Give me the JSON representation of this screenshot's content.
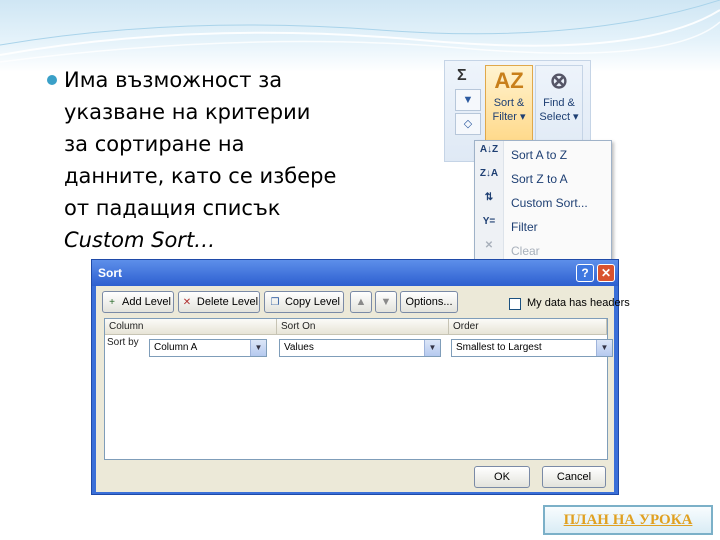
{
  "slide": {
    "bullet_lines": [
      "Има възможност за",
      "указване на критерии",
      "за сортиране на",
      "данните, като се избере",
      "от падащия списък"
    ],
    "bullet_italic": "Custom Sort…",
    "plan_link": "ПЛАН НА УРОКА"
  },
  "ribbon": {
    "sigma": "Σ",
    "sort_filter_line1": "Sort &",
    "sort_filter_line2": "Filter ▾",
    "find_select_line1": "Find &",
    "find_select_line2": "Select ▾",
    "menu": [
      {
        "icon": "A↓Z",
        "label": "Sort A to Z",
        "enabled": true
      },
      {
        "icon": "Z↓A",
        "label": "Sort Z to A",
        "enabled": true
      },
      {
        "icon": "⇅",
        "label": "Custom Sort...",
        "enabled": true
      },
      {
        "icon": "Y=",
        "label": "Filter",
        "enabled": true
      },
      {
        "icon": "✕",
        "label": "Clear",
        "enabled": false
      }
    ]
  },
  "dialog": {
    "title": "Sort",
    "help": "?",
    "close": "✕",
    "buttons": {
      "add_level": "Add Level",
      "delete_level": "Delete Level",
      "copy_level": "Copy Level",
      "move_up": "▲",
      "move_down": "▼",
      "options": "Options..."
    },
    "headers_checkbox_label": "My data has headers",
    "columns": [
      "Column",
      "Sort On",
      "Order"
    ],
    "row": {
      "label": "Sort by",
      "column_value": "Column A",
      "sort_on_value": "Values",
      "order_value": "Smallest to Largest"
    },
    "ok": "OK",
    "cancel": "Cancel"
  }
}
